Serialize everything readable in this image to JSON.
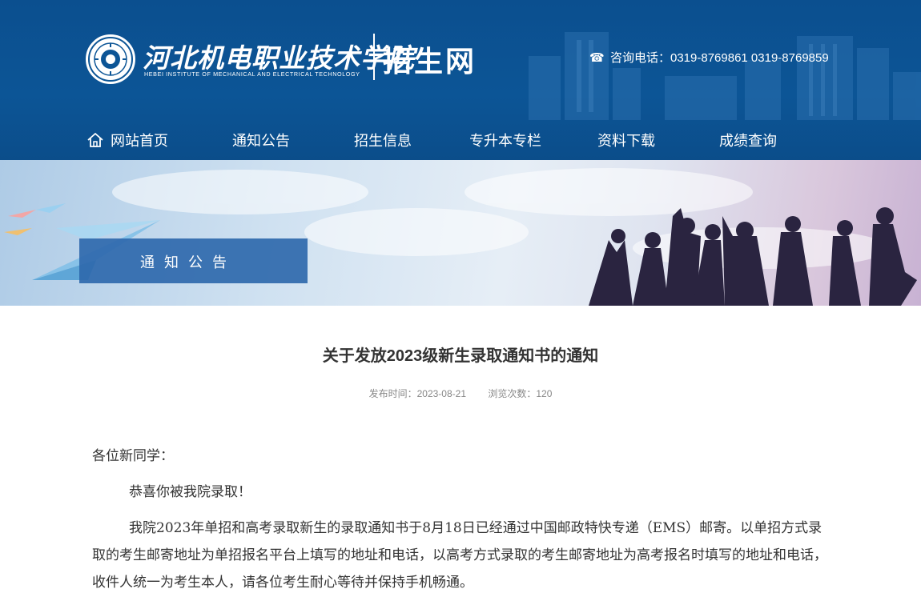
{
  "header": {
    "school_name_cn": "河北机电职业技术学院",
    "school_name_en": "HEBEI INSTITUTE OF MECHANICAL AND ELECTRICAL TECHNOLOGY",
    "site_name": "招生网",
    "hotline_label": "咨询电话：0319-8769861 0319-8769859",
    "phone_icon": "☎"
  },
  "nav": {
    "items": [
      {
        "label": "网站首页",
        "icon": "home-icon"
      },
      {
        "label": "通知公告"
      },
      {
        "label": "招生信息"
      },
      {
        "label": "专升本专栏"
      },
      {
        "label": "资料下载"
      },
      {
        "label": "成绩查询"
      }
    ]
  },
  "banner": {
    "section_title": "通知公告"
  },
  "article": {
    "title": "关于发放2023级新生录取通知书的通知",
    "publish_time": "发布时间：2023-08-21",
    "views": "浏览次数：120",
    "greeting": "各位新同学：",
    "paragraphs": [
      "恭喜你被我院录取！",
      "我院2023年单招和高考录取新生的录取通知书于8月18日已经通过中国邮政特快专递（EMS）邮寄。以单招方式录取的考生邮寄地址为单招报名平台上填写的地址和电话，以高考方式录取的考生邮寄地址为高考报名时填写的地址和电话，收件人统一为考生本人，请各位考生耐心等待并保持手机畅通。"
    ]
  },
  "colors": {
    "header_bg": "#0c5596",
    "banner_box": "#2f69ad",
    "text": "#333333",
    "meta_text": "#888888"
  }
}
